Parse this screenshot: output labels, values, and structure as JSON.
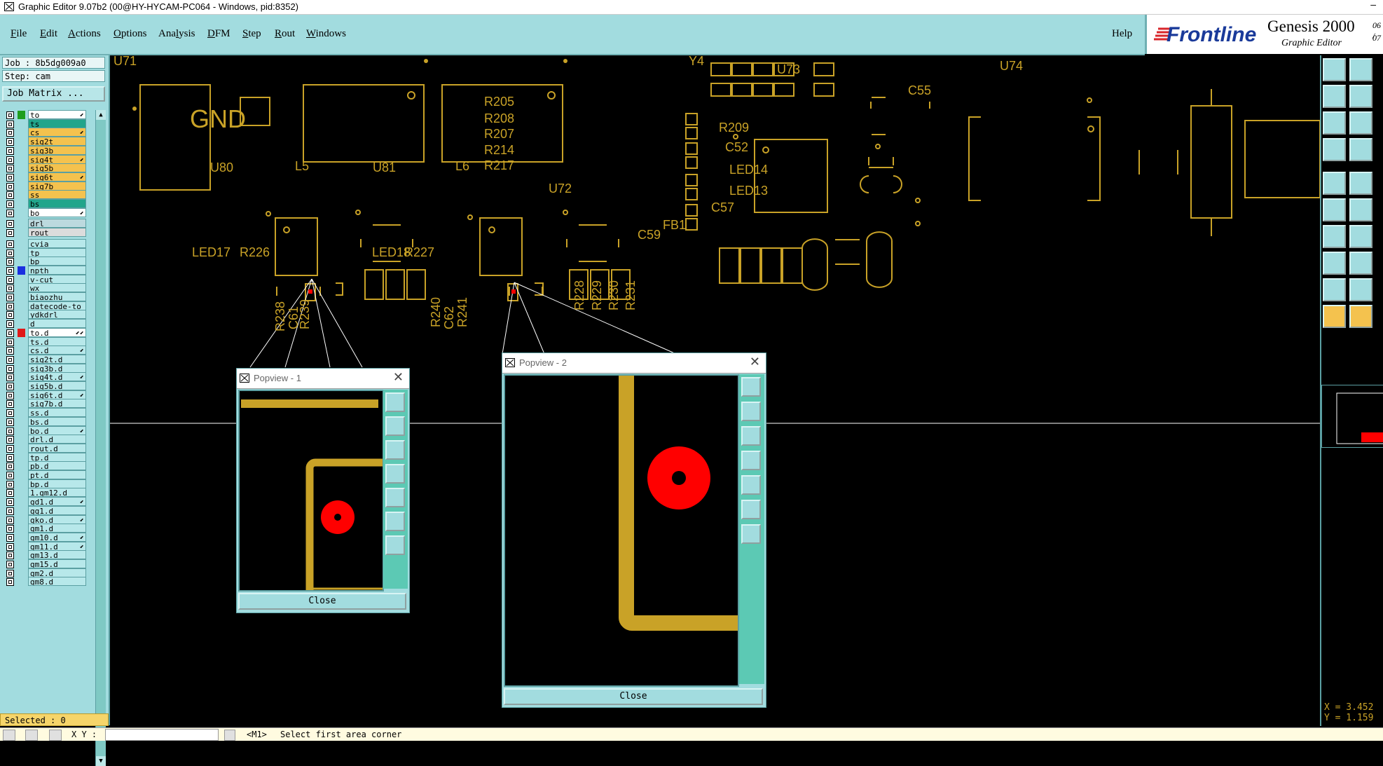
{
  "window": {
    "title": "Graphic Editor 9.07b2 (00@HY-HYCAM-PC064 - Windows, pid:8352)",
    "minimize": "–"
  },
  "menu": {
    "file": {
      "u": "F",
      "rest": "ile"
    },
    "edit": {
      "u": "E",
      "rest": "dit"
    },
    "actions": {
      "u": "A",
      "rest": "ctions"
    },
    "options": {
      "u": "O",
      "rest": "ptions"
    },
    "analysis": {
      "pre": "Ana",
      "u": "l",
      "rest": "ysis"
    },
    "dfm": {
      "u": "D",
      "rest": "FM"
    },
    "step": {
      "u": "S",
      "rest": "tep"
    },
    "rout": {
      "u": "R",
      "rest": "out"
    },
    "windows": {
      "u": "W",
      "rest": "indows"
    },
    "help": {
      "label": "Help"
    }
  },
  "brand": {
    "logo": "Frontline",
    "product": "Genesis 2000",
    "subtitle": "Graphic Editor",
    "d1": "06 /",
    "d2": "07"
  },
  "job": {
    "job_text": "Job : 8b5dg009a0",
    "step_text": "Step: cam",
    "matrix_button": "Job Matrix ..."
  },
  "layers": [
    {
      "name": "to",
      "bg": "#ffffff",
      "swatch": "#1f9e1f",
      "flag": "⬋"
    },
    {
      "name": "ts",
      "bg": "#21a58b",
      "swatch": "",
      "flag": ""
    },
    {
      "name": "cs",
      "bg": "#f4c24e",
      "swatch": "",
      "flag": "⬋"
    },
    {
      "name": "sig2t",
      "bg": "#f4c24e",
      "swatch": "",
      "flag": ""
    },
    {
      "name": "sig3b",
      "bg": "#f4c24e",
      "swatch": "",
      "flag": ""
    },
    {
      "name": "sig4t",
      "bg": "#f4c24e",
      "swatch": "",
      "flag": "⬋"
    },
    {
      "name": "sig5b",
      "bg": "#f4c24e",
      "swatch": "",
      "flag": ""
    },
    {
      "name": "sig6t",
      "bg": "#f4c24e",
      "swatch": "",
      "flag": "⬋"
    },
    {
      "name": "sig7b",
      "bg": "#f4c24e",
      "swatch": "",
      "flag": ""
    },
    {
      "name": "ss",
      "bg": "#f4c24e",
      "swatch": "",
      "flag": ""
    },
    {
      "name": "bs",
      "bg": "#21a58b",
      "swatch": "",
      "flag": ""
    },
    {
      "name": "bo",
      "bg": "#ffffff",
      "swatch": "",
      "flag": "⬋"
    },
    {
      "name": "drl",
      "bg": "#bcd9de",
      "swatch": "",
      "flag": "",
      "gap": 1
    },
    {
      "name": "rout",
      "bg": "#dcdcdc",
      "swatch": "",
      "flag": ""
    },
    {
      "name": "cvia",
      "bg": "#b7e8ea",
      "swatch": "",
      "flag": "",
      "gap": 1
    },
    {
      "name": "tp",
      "bg": "#b7e8ea",
      "swatch": "",
      "flag": ""
    },
    {
      "name": "bp",
      "bg": "#b7e8ea",
      "swatch": "",
      "flag": ""
    },
    {
      "name": "npth",
      "bg": "#b7e8ea",
      "swatch": "#1a2fe0",
      "flag": ""
    },
    {
      "name": "v-cut",
      "bg": "#b7e8ea",
      "swatch": "",
      "flag": ""
    },
    {
      "name": "wx",
      "bg": "#b7e8ea",
      "swatch": "",
      "flag": ""
    },
    {
      "name": "biaozhu",
      "bg": "#b7e8ea",
      "swatch": "",
      "flag": ""
    },
    {
      "name": "datecode-to",
      "bg": "#b7e8ea",
      "swatch": "",
      "flag": ""
    },
    {
      "name": "ydkdrl",
      "bg": "#b7e8ea",
      "swatch": "",
      "flag": ""
    },
    {
      "name": "d",
      "bg": "#b7e8ea",
      "swatch": "",
      "flag": ""
    },
    {
      "name": "to.d",
      "bg": "#ffffff",
      "swatch": "#e01818",
      "flag": "⬋⬋"
    },
    {
      "name": "ts.d",
      "bg": "#b7e8ea",
      "swatch": "",
      "flag": ""
    },
    {
      "name": "cs.d",
      "bg": "#b7e8ea",
      "swatch": "",
      "flag": "⬋"
    },
    {
      "name": "sig2t.d",
      "bg": "#b7e8ea",
      "swatch": "",
      "flag": ""
    },
    {
      "name": "sig3b.d",
      "bg": "#b7e8ea",
      "swatch": "",
      "flag": ""
    },
    {
      "name": "sig4t.d",
      "bg": "#b7e8ea",
      "swatch": "",
      "flag": "⬋"
    },
    {
      "name": "sig5b.d",
      "bg": "#b7e8ea",
      "swatch": "",
      "flag": ""
    },
    {
      "name": "sig6t.d",
      "bg": "#b7e8ea",
      "swatch": "",
      "flag": "⬋"
    },
    {
      "name": "sig7b.d",
      "bg": "#b7e8ea",
      "swatch": "",
      "flag": ""
    },
    {
      "name": "ss.d",
      "bg": "#b7e8ea",
      "swatch": "",
      "flag": ""
    },
    {
      "name": "bs.d",
      "bg": "#b7e8ea",
      "swatch": "",
      "flag": ""
    },
    {
      "name": "bo.d",
      "bg": "#b7e8ea",
      "swatch": "",
      "flag": "⬋"
    },
    {
      "name": "drl.d",
      "bg": "#b7e8ea",
      "swatch": "",
      "flag": ""
    },
    {
      "name": "rout.d",
      "bg": "#b7e8ea",
      "swatch": "",
      "flag": ""
    },
    {
      "name": "tp.d",
      "bg": "#b7e8ea",
      "swatch": "",
      "flag": ""
    },
    {
      "name": "pb.d",
      "bg": "#b7e8ea",
      "swatch": "",
      "flag": ""
    },
    {
      "name": "pt.d",
      "bg": "#b7e8ea",
      "swatch": "",
      "flag": ""
    },
    {
      "name": "bp.d",
      "bg": "#b7e8ea",
      "swatch": "",
      "flag": ""
    },
    {
      "name": "1.gm12.d",
      "bg": "#b7e8ea",
      "swatch": "",
      "flag": ""
    },
    {
      "name": "gd1.d",
      "bg": "#b7e8ea",
      "swatch": "",
      "flag": "⬋"
    },
    {
      "name": "gg1.d",
      "bg": "#b7e8ea",
      "swatch": "",
      "flag": ""
    },
    {
      "name": "gko.d",
      "bg": "#b7e8ea",
      "swatch": "",
      "flag": "⬋"
    },
    {
      "name": "gm1.d",
      "bg": "#b7e8ea",
      "swatch": "",
      "flag": ""
    },
    {
      "name": "gm10.d",
      "bg": "#b7e8ea",
      "swatch": "",
      "flag": "⬋"
    },
    {
      "name": "gm11.d",
      "bg": "#b7e8ea",
      "swatch": "",
      "flag": "⬋"
    },
    {
      "name": "gm13.d",
      "bg": "#b7e8ea",
      "swatch": "",
      "flag": ""
    },
    {
      "name": "gm15.d",
      "bg": "#b7e8ea",
      "swatch": "",
      "flag": ""
    },
    {
      "name": "gm2.d",
      "bg": "#b7e8ea",
      "swatch": "",
      "flag": ""
    },
    {
      "name": "gm8.d",
      "bg": "#b7e8ea",
      "swatch": "",
      "flag": ""
    }
  ],
  "selected": "Selected : 0",
  "status": {
    "xy_label": "X Y :",
    "prompt_tag": "<M1>",
    "prompt": "Select first area corner"
  },
  "coords": {
    "x": "X = 3.452",
    "y": "Y = 1.159"
  },
  "pcb_labels": [
    "U71",
    "GND",
    "R205",
    "R208",
    "R207",
    "R214",
    "R217",
    "Y4",
    "U73",
    "U74",
    "C55",
    "R209",
    "C52",
    "LED14",
    "LED13",
    "U80",
    "L5",
    "U81",
    "L6",
    "U72",
    "C57",
    "FB1",
    "C59",
    "LED17",
    "R226",
    "LED18",
    "R227",
    "R238",
    "C61",
    "R239",
    "R240",
    "C62",
    "R241",
    "R228",
    "R229",
    "R230",
    "R231"
  ],
  "popview1": {
    "title": "Popview - 1",
    "close_label": "Close"
  },
  "popview2": {
    "title": "Popview - 2",
    "close_label": "Close"
  },
  "colors": {
    "copper": "#c9a227",
    "pad": "#ff0000",
    "panel": "#a2dcdf",
    "accent": "#5cc9b4"
  }
}
